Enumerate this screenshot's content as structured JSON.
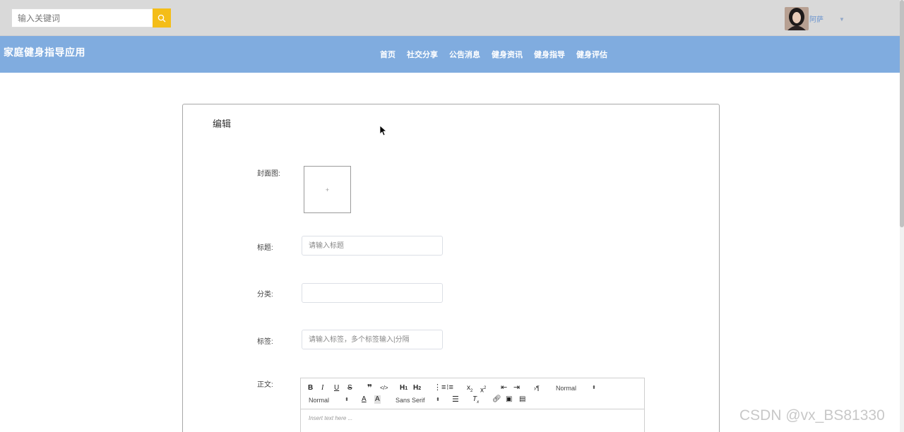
{
  "header": {
    "search": {
      "placeholder": "输入关键词",
      "value": ""
    },
    "user": {
      "name": "阿萨"
    }
  },
  "navbar": {
    "brand": "家庭健身指导应用",
    "items": [
      "首页",
      "社交分享",
      "公告消息",
      "健身资讯",
      "健身指导",
      "健身评估"
    ]
  },
  "form": {
    "title": "编辑",
    "cover_label": "封面图:",
    "cover_plus": "+",
    "title_label": "标题:",
    "title_placeholder": "请输入标题",
    "category_label": "分类:",
    "category_value": "",
    "tags_label": "标签:",
    "tags_placeholder": "请输入标签，多个标签输入|分隔",
    "content_label": "正文:"
  },
  "editor": {
    "header_select": "Normal",
    "size_select": "Normal",
    "font_select": "Sans Serif",
    "placeholder": "Insert text here ..."
  },
  "watermark": "CSDN @vx_BS81330",
  "colors": {
    "navbar": "#80acdf",
    "topbar": "#d9d9d9",
    "search_button": "#f4bd18"
  }
}
